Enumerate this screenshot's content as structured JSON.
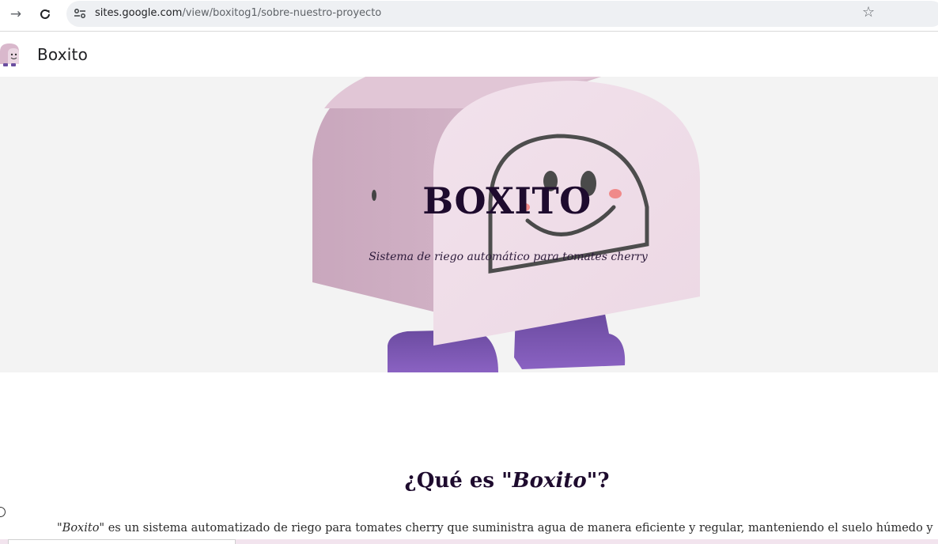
{
  "browser": {
    "url_domain": "sites.google.com",
    "url_path": "/view/boxitog1/sobre-nuestro-proyecto",
    "icons": [
      "forward-arrow-icon",
      "reload-icon",
      "site-info-icon",
      "bookmark-star-icon"
    ]
  },
  "site": {
    "name": "Boxito"
  },
  "hero": {
    "title": "BOXITO",
    "subtitle": "Sistema de riego automático para tomates cherry"
  },
  "section": {
    "title_prefix": "¿Qué es ",
    "title_emphasis": "\"Boxito\"",
    "title_suffix": "?",
    "body_emphasis": "\"Boxito\"",
    "body_rest": " es un sistema automatizado de riego para tomates cherry que suministra agua de manera eficiente y regular, manteniendo el suelo húmedo y regando"
  },
  "colors": {
    "hero_background": "#f3f3f3",
    "robot_body": "#e9d3e0",
    "robot_feet": "#7a55b0",
    "title_color": "#1e0b2e"
  }
}
